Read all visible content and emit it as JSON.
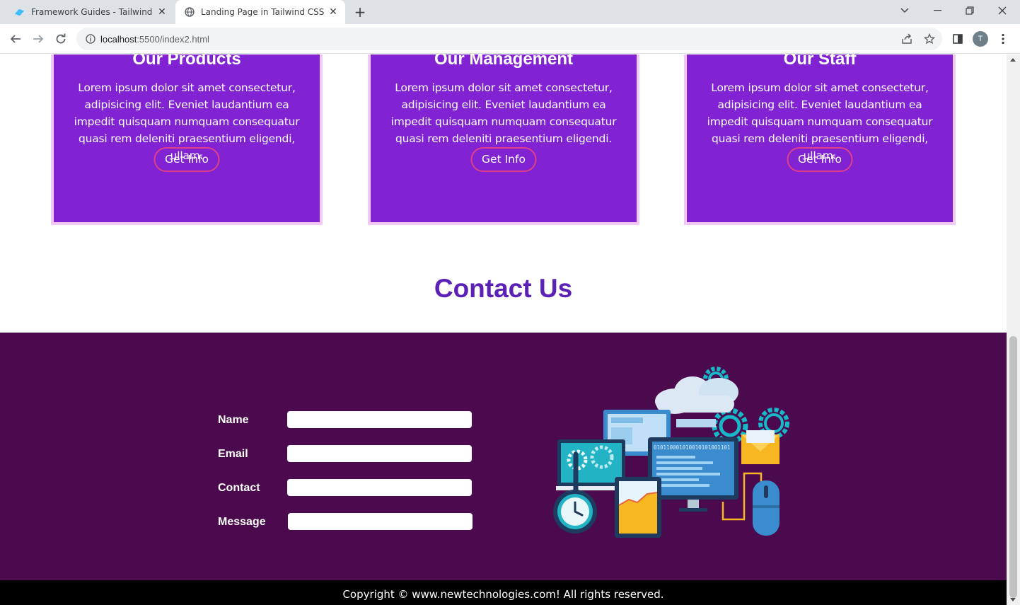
{
  "browser": {
    "tabs": [
      {
        "title": "Framework Guides - Tailwind CSS",
        "active": false
      },
      {
        "title": "Landing Page in Tailwind CSS",
        "active": true
      }
    ],
    "url_host": "localhost",
    "url_path": ":5500/index2.html",
    "profile_initial": "T",
    "icons": {
      "back": "back-arrow-icon",
      "forward": "forward-arrow-icon",
      "reload": "reload-icon",
      "info": "info-icon",
      "share": "share-icon",
      "bookmark": "star-icon",
      "sidepanel": "side-panel-icon",
      "menu": "kebab-menu-icon"
    }
  },
  "cards": [
    {
      "title": "Our Products",
      "body": "Lorem ipsum dolor sit amet consectetur, adipisicing elit. Eveniet laudantium ea impedit quisquam numquam consequatur quasi rem deleniti praesentium eligendi, ullam.",
      "button": "Get Info"
    },
    {
      "title": "Our Management",
      "body": "Lorem ipsum dolor sit amet consectetur, adipisicing elit. Eveniet laudantium ea impedit quisquam numquam consequatur quasi rem deleniti praesentium eligendi.",
      "button": "Get Info"
    },
    {
      "title": "Our Staff",
      "body": "Lorem ipsum dolor sit amet consectetur, adipisicing elit. Eveniet laudantium ea impedit quisquam numquam consequatur quasi rem deleniti praesentium eligendi, ullam.",
      "button": "Get Info"
    }
  ],
  "contact": {
    "heading": "Contact Us",
    "fields": [
      {
        "label": "Name",
        "value": ""
      },
      {
        "label": "Email",
        "value": ""
      },
      {
        "label": "Contact",
        "value": ""
      },
      {
        "label": "Message",
        "value": ""
      }
    ],
    "illustration_text": "010110001010010101001101"
  },
  "footer": {
    "text": "Copyright © www.newtechnologies.com! All rights reserved."
  },
  "colors": {
    "card_bg": "#8122d3",
    "card_border": "#f3c8f5",
    "button_border": "#e0408a",
    "heading": "#5b21b6",
    "contact_bg": "#4a0a4d",
    "footer_bg": "#000000"
  }
}
